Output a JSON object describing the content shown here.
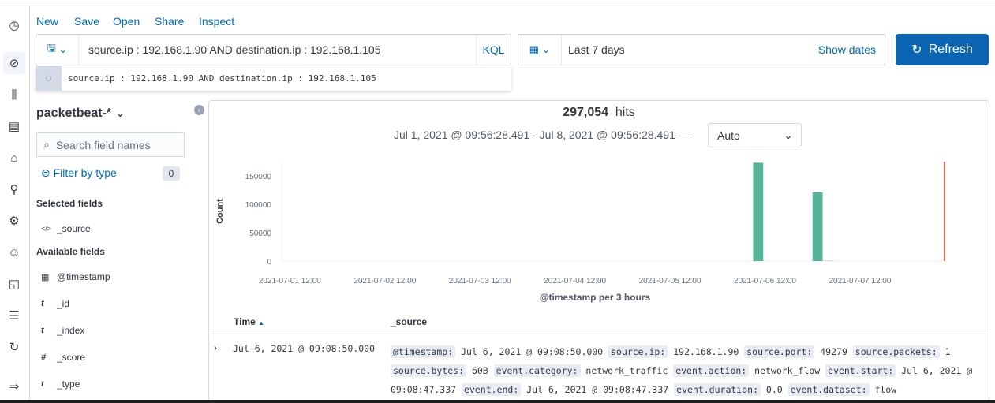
{
  "menu": {
    "new": "New",
    "save": "Save",
    "open": "Open",
    "share": "Share",
    "inspect": "Inspect"
  },
  "query": {
    "value": "source.ip : 192.168.1.90 AND destination.ip : 192.168.1.105",
    "language": "KQL",
    "suggestion": "source.ip : 192.168.1.90 AND destination.ip : 192.168.1.105"
  },
  "date": {
    "label": "Last 7 days",
    "show_dates": "Show dates"
  },
  "refresh_label": "Refresh",
  "sidebar": {
    "index_pattern": "packetbeat-*",
    "search_placeholder": "Search field names",
    "filter_by_type": "Filter by type",
    "filter_count": "0",
    "selected_heading": "Selected fields",
    "selected": [
      {
        "type": "</>",
        "name": "_source"
      }
    ],
    "available_heading": "Available fields",
    "available": [
      {
        "type": "date",
        "name": "@timestamp"
      },
      {
        "type": "t",
        "name": "_id"
      },
      {
        "type": "t",
        "name": "_index"
      },
      {
        "type": "#",
        "name": "_score"
      },
      {
        "type": "t",
        "name": "_type"
      }
    ]
  },
  "hits": {
    "count": "297,054",
    "label": "hits",
    "range": "Jul 1, 2021 @ 09:56:28.491 - Jul 8, 2021 @ 09:56:28.491 —",
    "interval": "Auto"
  },
  "chart_data": {
    "type": "bar",
    "xlabel": "@timestamp per 3 hours",
    "ylabel": "Count",
    "ylim": [
      0,
      175000
    ],
    "yticks": [
      0,
      50000,
      100000,
      150000
    ],
    "xticks": [
      "2021-07-01 12:00",
      "2021-07-02 12:00",
      "2021-07-03 12:00",
      "2021-07-04 12:00",
      "2021-07-05 12:00",
      "2021-07-06 12:00",
      "2021-07-07 12:00"
    ],
    "xrange": [
      "2021-07-01 09:56",
      "2021-07-08 09:56"
    ],
    "bars": [
      {
        "x": "2021-07-06 09:00",
        "value": 173000
      },
      {
        "x": "2021-07-07 00:00",
        "value": 121000
      },
      {
        "x": "2021-07-07 03:00",
        "value": 1000
      }
    ],
    "now_marker": "2021-07-08 09:56",
    "color": "#54b399",
    "marker_color": "#e7664c"
  },
  "table": {
    "headers": [
      "Time",
      "_source"
    ],
    "rows": [
      {
        "time": "Jul 6, 2021 @ 09:08:50.000",
        "fields": [
          [
            "@timestamp:",
            "Jul 6, 2021 @ 09:08:50.000"
          ],
          [
            "source.ip:",
            "192.168.1.90"
          ],
          [
            "source.port:",
            "49279"
          ],
          [
            "source.packets:",
            "1"
          ],
          [
            "source.bytes:",
            "60B"
          ],
          [
            "event.category:",
            "network_traffic"
          ],
          [
            "event.action:",
            "network_flow"
          ],
          [
            "event.start:",
            "Jul 6, 2021 @ 09:08:47.337"
          ],
          [
            "event.end:",
            "Jul 6, 2021 @ 09:08:47.337"
          ],
          [
            "event.duration:",
            "0.0"
          ],
          [
            "event.dataset:",
            "flow"
          ]
        ]
      }
    ]
  }
}
